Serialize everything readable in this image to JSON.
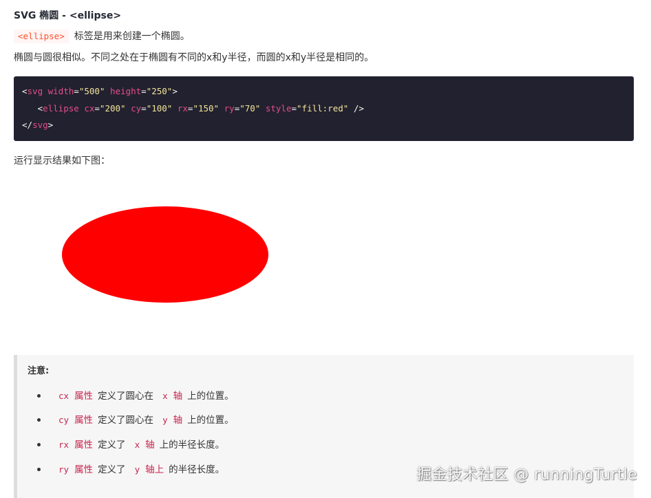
{
  "article": {
    "heading": "SVG 椭圆 - <ellipse>",
    "intro_tag_code": "<ellipse>",
    "intro_tag_text": "标签是用来创建一个椭圆。",
    "intro_paragraph": "椭圆与圆很相似。不同之处在于椭圆有不同的x和y半径，而圆的x和y半径是相同的。",
    "result_text": "运行显示结果如下图："
  },
  "code_block": {
    "line1": {
      "open": "<",
      "tag": "svg",
      "attr1": "width",
      "eq1": "=",
      "val1": "\"500\"",
      "attr2": "height",
      "eq2": "=",
      "val2": "\"250\"",
      "close": ">"
    },
    "line2": {
      "indent": "   ",
      "open": "<",
      "tag": "ellipse",
      "attr1": "cx",
      "val1": "\"200\"",
      "attr2": "cy",
      "val2": "\"100\"",
      "attr3": "rx",
      "val3": "\"150\"",
      "attr4": "ry",
      "val4": "\"70\"",
      "attr5": "style",
      "val5": "\"fill:red\"",
      "close": " />"
    },
    "line3": {
      "open": "</",
      "tag": "svg",
      "close": ">"
    }
  },
  "demo": {
    "fill_color": "#ff0000"
  },
  "note": {
    "title": "注意:",
    "items": [
      {
        "code": "cx",
        "attr_word": "属性",
        "text1": "定义了圆心在",
        "axis": "x",
        "axis_word": "轴",
        "text2": "上的位置。"
      },
      {
        "code": "cy",
        "attr_word": "属性",
        "text1": "定义了圆心在",
        "axis": "y",
        "axis_word": "轴",
        "text2": "上的位置。"
      },
      {
        "code": "rx",
        "attr_word": "属性",
        "text1": "定义了",
        "axis": "x",
        "axis_word": "轴",
        "text2": "上的半径长度。"
      },
      {
        "code": "ry",
        "attr_word": "属性",
        "text1": "定义了",
        "axis": "y",
        "axis_word": "轴上",
        "text2": "的半径长度。"
      }
    ]
  },
  "watermark": "掘金技术社区 @ runningTurtle"
}
